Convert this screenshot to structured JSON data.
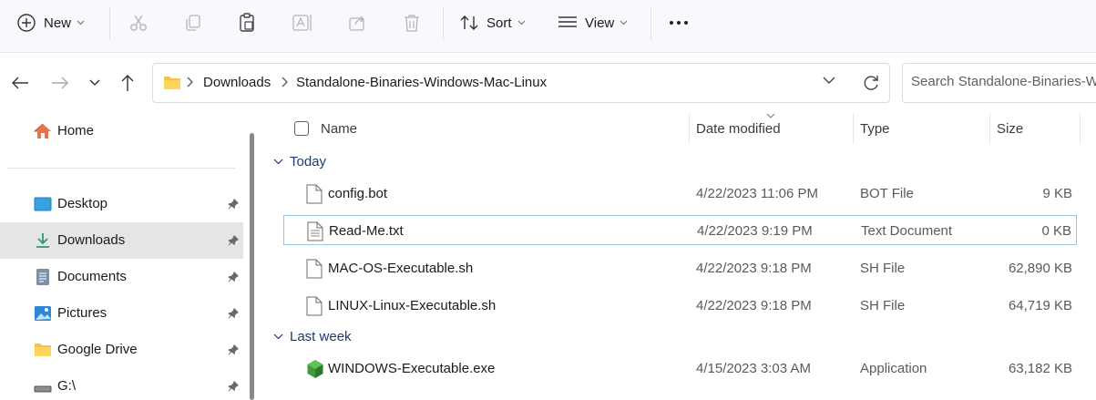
{
  "toolbar": {
    "new_label": "New",
    "sort_label": "Sort",
    "view_label": "View"
  },
  "address": {
    "crumbs": [
      "Downloads",
      "Standalone-Binaries-Windows-Mac-Linux"
    ]
  },
  "search": {
    "placeholder": "Search Standalone-Binaries-Windows-Mac-Linux"
  },
  "sidebar": {
    "items": [
      {
        "label": "Home",
        "icon": "home-icon"
      },
      {
        "label": "Desktop",
        "icon": "desktop-icon",
        "pinned": true
      },
      {
        "label": "Downloads",
        "icon": "download-icon",
        "pinned": true,
        "selected": true
      },
      {
        "label": "Documents",
        "icon": "documents-icon",
        "pinned": true
      },
      {
        "label": "Pictures",
        "icon": "pictures-icon",
        "pinned": true
      },
      {
        "label": "Google Drive",
        "icon": "folder-icon",
        "pinned": true
      },
      {
        "label": "G:\\",
        "icon": "drive-icon",
        "pinned": true
      }
    ]
  },
  "columns": {
    "name": "Name",
    "date": "Date modified",
    "type": "Type",
    "size": "Size"
  },
  "groups": [
    {
      "label": "Today",
      "files": [
        {
          "name": "config.bot",
          "date": "4/22/2023 11:06 PM",
          "type": "BOT File",
          "size": "9 KB",
          "icon": "file-icon"
        },
        {
          "name": "Read-Me.txt",
          "date": "4/22/2023 9:19 PM",
          "type": "Text Document",
          "size": "0 KB",
          "icon": "text-file-icon"
        },
        {
          "name": "MAC-OS-Executable.sh",
          "date": "4/22/2023 9:18 PM",
          "type": "SH File",
          "size": "62,890 KB",
          "icon": "file-icon"
        },
        {
          "name": "LINUX-Linux-Executable.sh",
          "date": "4/22/2023 9:18 PM",
          "type": "SH File",
          "size": "64,719 KB",
          "icon": "file-icon"
        }
      ]
    },
    {
      "label": "Last week",
      "files": [
        {
          "name": "WINDOWS-Executable.exe",
          "date": "4/15/2023 3:03 AM",
          "type": "Application",
          "size": "63,182 KB",
          "icon": "app-cube-icon"
        }
      ]
    }
  ],
  "colors": {
    "accent": "#0067c0",
    "selected_bg": "#e5e5e5",
    "group_text": "#1f3a6a",
    "focus_border": "#99c6e8"
  }
}
